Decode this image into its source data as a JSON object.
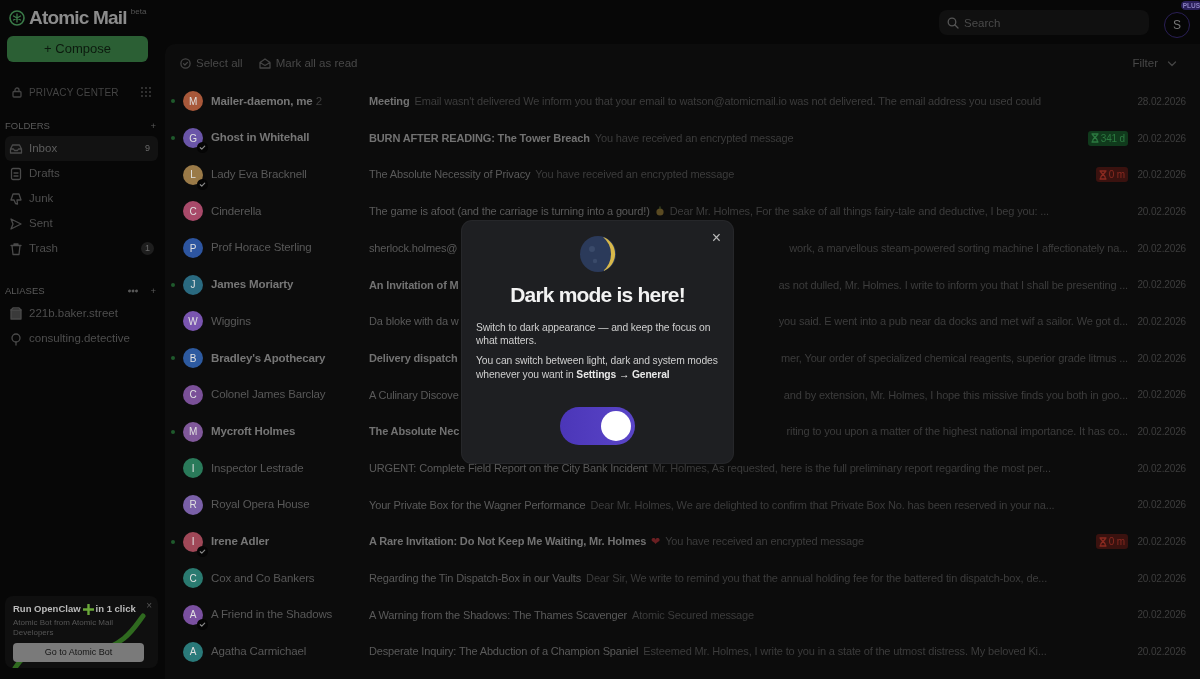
{
  "brand": {
    "name": "Atomic Mail",
    "tag": "beta"
  },
  "compose_button": "+ Compose",
  "privacy_center": "PRIVACY CENTER",
  "folders": {
    "heading": "FOLDERS",
    "add": "+",
    "items": [
      {
        "label": "Inbox",
        "count": "9",
        "count_pill": false,
        "selected": true
      },
      {
        "label": "Drafts",
        "selected": false
      },
      {
        "label": "Junk",
        "selected": false
      },
      {
        "label": "Sent",
        "selected": false
      },
      {
        "label": "Trash",
        "count": "1",
        "count_pill": true,
        "selected": false
      }
    ]
  },
  "aliases": {
    "heading": "ALIASES",
    "add": "+",
    "items": [
      {
        "label": "221b.baker.street"
      },
      {
        "label": "consulting.detective"
      }
    ]
  },
  "promo": {
    "title": "Run OpenClaw",
    "title_tail": "in 1 click",
    "text": "Atomic Bot from Atomic Mail Developers",
    "button": "Go to Atomic Bot",
    "close": "×"
  },
  "search": {
    "placeholder": "Search"
  },
  "account": {
    "initial": "S",
    "plan": "PLUS"
  },
  "toolbar": {
    "select_all": "Select all",
    "mark_read": "Mark all as read",
    "filter": "Filter"
  },
  "messages": [
    {
      "kind": "full",
      "sender": "Mailer-daemon, me",
      "thread_count": "2",
      "unread": true,
      "verified": false,
      "initial": "M",
      "color": "#a8583a",
      "subject": "Meeting",
      "preview": "Email wasn't delivered We inform you that your email to watson@atomicmail.io was not delivered. The email address you used could",
      "date": "28.02.2026"
    },
    {
      "kind": "full",
      "sender": "Ghost in Whitehall",
      "unread": true,
      "verified": true,
      "initial": "G",
      "color": "#6a55a8",
      "subject": "BURN AFTER READING: The Tower Breach",
      "preview": "You have received an encrypted message",
      "timer": {
        "kind": "active",
        "text": "341 d"
      },
      "date": "20.02.2026"
    },
    {
      "kind": "full",
      "sender": "Lady Eva Bracknell",
      "unread": false,
      "verified": true,
      "initial": "L",
      "color": "#9a7a48",
      "subject": "The Absolute Necessity of Privacy",
      "preview": "You have received an encrypted message",
      "timer": {
        "kind": "expired",
        "text": "0 m"
      },
      "date": "20.02.2026"
    },
    {
      "kind": "full",
      "sender": "Cinderella",
      "unread": false,
      "verified": false,
      "initial": "C",
      "color": "#a84a6a",
      "subject": "The game is afoot (and the carriage is turning into a gourd!)",
      "subject_icon": true,
      "preview": "Dear Mr. Holmes, For the sake of all things fairy-tale and deductive, I beg you: ...",
      "date": "20.02.2026"
    },
    {
      "kind": "partly_hidden",
      "sender": "Prof Horace Sterling",
      "unread": false,
      "verified": false,
      "initial": "P",
      "color": "#2d55a0",
      "subject": "sherlock.holmes@",
      "preview": "work, a marvellous steam-powered sorting machine I affectionately na...",
      "date": "20.02.2026"
    },
    {
      "kind": "partly_hidden",
      "sender": "James Moriarty",
      "unread": true,
      "verified": false,
      "initial": "J",
      "color": "#2a6a80",
      "subject": "An Invitation of M",
      "preview": "as not dulled, Mr. Holmes. I write to inform you that I shall be presenting ...",
      "date": "20.02.2026"
    },
    {
      "kind": "partly_hidden",
      "sender": "Wiggins",
      "unread": false,
      "verified": false,
      "initial": "W",
      "color": "#7a55b0",
      "subject": "Da bloke with da w",
      "preview": "you said. E went into a pub near da docks and met wif a sailor. We got d...",
      "date": "20.02.2026"
    },
    {
      "kind": "partly_hidden",
      "sender": "Bradley's Apothecary",
      "unread": true,
      "verified": false,
      "initial": "B",
      "color": "#2d5aa0",
      "subject": "Delivery dispatch",
      "preview": "mer, Your order of specialized chemical reagents, superior grade litmus ...",
      "date": "20.02.2026"
    },
    {
      "kind": "partly_hidden",
      "sender": "Colonel James Barclay",
      "unread": false,
      "verified": false,
      "initial": "C",
      "color": "#7a5098",
      "subject": "A Culinary Discove",
      "preview": "and by extension, Mr. Holmes, I hope this missive finds you both in goo...",
      "date": "20.02.2026"
    },
    {
      "kind": "partly_hidden",
      "sender": "Mycroft Holmes",
      "unread": true,
      "verified": false,
      "initial": "M",
      "color": "#80589a",
      "subject": "The Absolute Nec",
      "preview": "riting to you upon a matter of the highest national importance. It has co...",
      "date": "20.02.2026"
    },
    {
      "kind": "full",
      "sender": "Inspector Lestrade",
      "unread": false,
      "verified": false,
      "initial": "I",
      "color": "#2a7a5a",
      "subject": "URGENT: Complete Field Report on the City Bank Incident",
      "preview": "Mr. Holmes, As requested, here is the full preliminary report regarding the most per...",
      "date": "20.02.2026"
    },
    {
      "kind": "full",
      "sender": "Royal Opera House",
      "unread": false,
      "verified": false,
      "initial": "R",
      "color": "#7a60a8",
      "subject": "Your Private Box for the Wagner Performance",
      "preview": "Dear Mr. Holmes, We are delighted to confirm that Private Box No. has been reserved in your na...",
      "date": "20.02.2026"
    },
    {
      "kind": "full",
      "sender": "Irene Adler",
      "unread": true,
      "verified": true,
      "initial": "I",
      "color": "#a04858",
      "subject": "A Rare Invitation: Do Not Keep Me Waiting, Mr. Holmes",
      "subject_emoji": "❤",
      "preview": "You have received an encrypted message",
      "timer": {
        "kind": "expired",
        "text": "0 m"
      },
      "date": "20.02.2026"
    },
    {
      "kind": "full",
      "sender": "Cox and Co Bankers",
      "unread": false,
      "verified": false,
      "initial": "C",
      "color": "#2a7a70",
      "subject": "Regarding the Tin Dispatch-Box in our Vaults",
      "preview": "Dear Sir, We write to remind you that the annual holding fee for the battered tin dispatch-box, de...",
      "date": "20.02.2026"
    },
    {
      "kind": "full",
      "sender": "A Friend in the Shadows",
      "unread": false,
      "verified": true,
      "initial": "A",
      "color": "#7a50a0",
      "subject": "A Warning from the Shadows: The Thames Scavenger",
      "preview": "Atomic Secured message",
      "date": "20.02.2026"
    },
    {
      "kind": "full",
      "sender": "Agatha Carmichael",
      "unread": false,
      "verified": false,
      "initial": "A",
      "color": "#2a7a7a",
      "subject": "Desperate Inquiry: The Abduction of a Champion Spaniel",
      "preview": "Esteemed Mr. Holmes, I write to you in a state of the utmost distress. My beloved Ki...",
      "date": "20.02.2026"
    }
  ],
  "modal": {
    "close": "×",
    "title": "Dark mode is here!",
    "paragraphs": [
      "Switch to dark appearance — and keep the focus on what matters.",
      "You can switch between light, dark and system modes whenever you want in **Settings → General**"
    ],
    "toggle_on": true
  }
}
